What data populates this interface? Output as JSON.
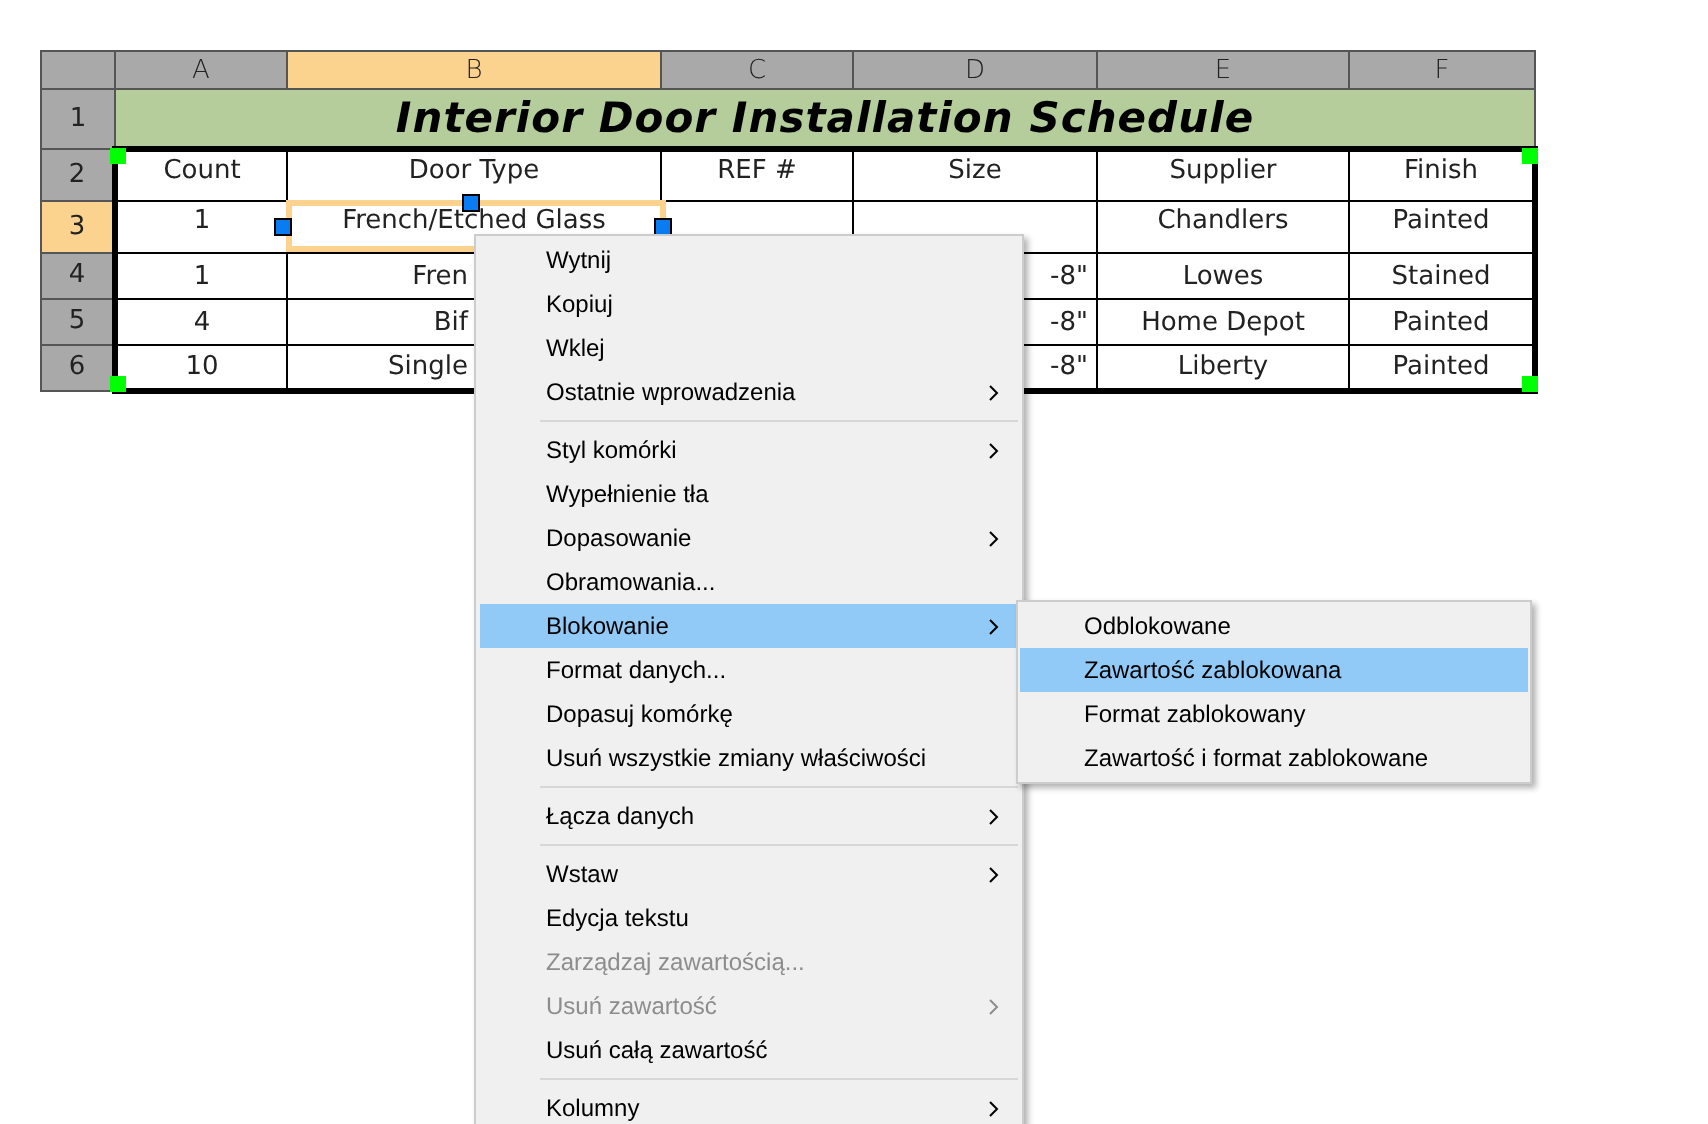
{
  "sheet": {
    "columns": [
      {
        "label": "A",
        "selected": false
      },
      {
        "label": "B",
        "selected": true
      },
      {
        "label": "C",
        "selected": false
      },
      {
        "label": "D",
        "selected": false
      },
      {
        "label": "E",
        "selected": false
      },
      {
        "label": "F",
        "selected": false
      }
    ],
    "title_row": {
      "header": "1",
      "selected": false,
      "title": "Interior Door Installation Schedule"
    },
    "rows": [
      {
        "header": "2",
        "selected": false,
        "cells": [
          "Count",
          "Door Type",
          "REF #",
          "Size",
          "Supplier",
          "Finish"
        ]
      },
      {
        "header": "3",
        "selected": true,
        "cells": [
          "1",
          "French/Etched Glass",
          "",
          "",
          "Chandlers",
          "Painted"
        ]
      },
      {
        "header": "4",
        "selected": false,
        "cells": [
          "1",
          "Fren",
          "",
          "-8\"",
          "Lowes",
          "Stained"
        ]
      },
      {
        "header": "5",
        "selected": false,
        "cells": [
          "4",
          "Bif",
          "",
          "-8\"",
          "Home Depot",
          "Painted"
        ]
      },
      {
        "header": "6",
        "selected": false,
        "cells": [
          "10",
          "Single",
          "",
          "-8\"",
          "Liberty",
          "Painted"
        ]
      }
    ]
  },
  "context_menu": {
    "items": [
      {
        "kind": "item",
        "label": "Wytnij",
        "submenu": false,
        "disabled": false,
        "selected": false
      },
      {
        "kind": "item",
        "label": "Kopiuj",
        "submenu": false,
        "disabled": false,
        "selected": false
      },
      {
        "kind": "item",
        "label": "Wklej",
        "submenu": false,
        "disabled": false,
        "selected": false
      },
      {
        "kind": "item",
        "label": "Ostatnie wprowadzenia",
        "submenu": true,
        "disabled": false,
        "selected": false
      },
      {
        "kind": "separator"
      },
      {
        "kind": "item",
        "label": "Styl komórki",
        "submenu": true,
        "disabled": false,
        "selected": false
      },
      {
        "kind": "item",
        "label": "Wypełnienie tła",
        "submenu": false,
        "disabled": false,
        "selected": false
      },
      {
        "kind": "item",
        "label": "Dopasowanie",
        "submenu": true,
        "disabled": false,
        "selected": false
      },
      {
        "kind": "item",
        "label": "Obramowania...",
        "submenu": false,
        "disabled": false,
        "selected": false
      },
      {
        "kind": "item",
        "label": "Blokowanie",
        "submenu": true,
        "disabled": false,
        "selected": true
      },
      {
        "kind": "item",
        "label": "Format danych...",
        "submenu": false,
        "disabled": false,
        "selected": false
      },
      {
        "kind": "item",
        "label": "Dopasuj komórkę",
        "submenu": false,
        "disabled": false,
        "selected": false
      },
      {
        "kind": "item",
        "label": "Usuń wszystkie zmiany właściwości",
        "submenu": false,
        "disabled": false,
        "selected": false
      },
      {
        "kind": "separator"
      },
      {
        "kind": "item",
        "label": "Łącza danych",
        "submenu": true,
        "disabled": false,
        "selected": false
      },
      {
        "kind": "separator"
      },
      {
        "kind": "item",
        "label": "Wstaw",
        "submenu": true,
        "disabled": false,
        "selected": false
      },
      {
        "kind": "item",
        "label": "Edycja tekstu",
        "submenu": false,
        "disabled": false,
        "selected": false
      },
      {
        "kind": "item",
        "label": "Zarządzaj zawartością...",
        "submenu": false,
        "disabled": true,
        "selected": false
      },
      {
        "kind": "item",
        "label": "Usuń zawartość",
        "submenu": true,
        "disabled": true,
        "selected": false
      },
      {
        "kind": "item",
        "label": "Usuń całą zawartość",
        "submenu": false,
        "disabled": false,
        "selected": false
      },
      {
        "kind": "separator"
      },
      {
        "kind": "item",
        "label": "Kolumny",
        "submenu": true,
        "disabled": false,
        "selected": false
      }
    ],
    "submenu": [
      {
        "label": "Odblokowane",
        "selected": false
      },
      {
        "label": "Zawartość zablokowana",
        "selected": true
      },
      {
        "label": "Format zablokowany",
        "selected": false
      },
      {
        "label": "Zawartość i format zablokowane",
        "selected": false
      }
    ]
  }
}
